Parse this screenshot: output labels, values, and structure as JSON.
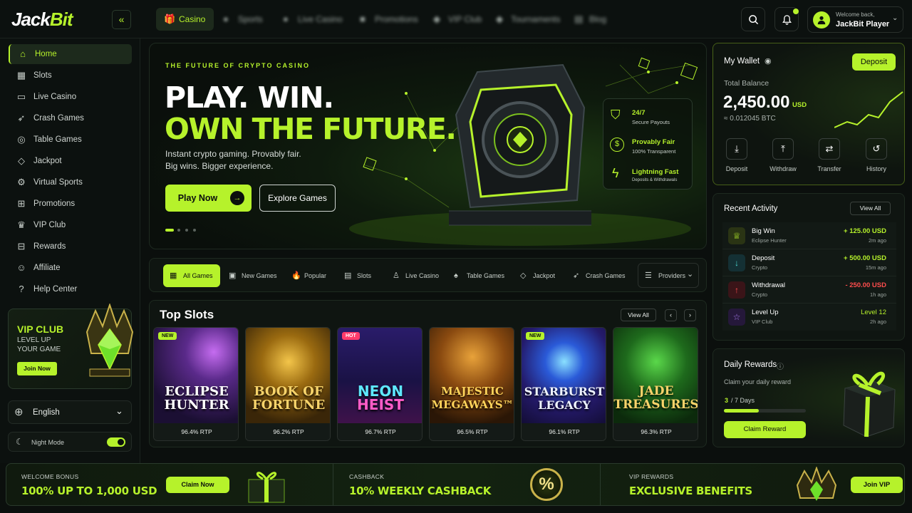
{
  "brand": {
    "logo_part1": "Jack",
    "logo_part2": "Bit"
  },
  "colors": {
    "accent": "#b6f22b",
    "background": "#0b0f0d",
    "up": "#b6f22b",
    "down": "#ff4d4d"
  },
  "top_nav": {
    "tabs": [
      {
        "label": "Casino",
        "icon": "gift-icon",
        "active": true
      },
      {
        "label": "Sports",
        "icon": "ball-icon"
      },
      {
        "label": "Live Casino",
        "icon": "dice-icon"
      },
      {
        "label": "Promotions",
        "icon": "gift-icon"
      },
      {
        "label": "VIP Club",
        "icon": "diamond-icon"
      },
      {
        "label": "Tournaments",
        "icon": "diamond-icon"
      },
      {
        "label": "Blog",
        "icon": "news-icon"
      }
    ]
  },
  "user": {
    "greeting": "Welcome back,",
    "name": "JackBit Player"
  },
  "sidebar": {
    "items": [
      {
        "label": "Home",
        "icon": "home-icon",
        "active": true
      },
      {
        "label": "Slots",
        "icon": "slots-icon"
      },
      {
        "label": "Live Casino",
        "icon": "live-casino-icon"
      },
      {
        "label": "Crash Games",
        "icon": "rocket-icon"
      },
      {
        "label": "Table Games",
        "icon": "table-icon"
      },
      {
        "label": "Jackpot",
        "icon": "jackpot-icon"
      },
      {
        "label": "Virtual Sports",
        "icon": "virtual-sports-icon"
      },
      {
        "label": "Promotions",
        "icon": "gift-icon"
      },
      {
        "label": "VIP Club",
        "icon": "crown-icon"
      },
      {
        "label": "Rewards",
        "icon": "rewards-icon"
      },
      {
        "label": "Affiliate",
        "icon": "user-icon"
      },
      {
        "label": "Help Center",
        "icon": "help-icon"
      }
    ],
    "vip": {
      "title": "VIP CLUB",
      "line1": "LEVEL UP",
      "line2": "YOUR GAME",
      "button": "Join Now"
    },
    "language": "English",
    "night_mode": {
      "label": "Night Mode",
      "on": true
    }
  },
  "hero": {
    "eyebrow": "THE FUTURE OF CRYPTO CASINO",
    "headline1": "PLAY. WIN.",
    "headline2": "OWN THE FUTURE.",
    "sub1": "Instant crypto gaming. Provably fair.",
    "sub2": "Big wins. Bigger experience.",
    "primary_button": "Play Now",
    "secondary_button": "Explore Games",
    "features": [
      {
        "title": "24/7",
        "sub": "Secure Payouts",
        "icon": "shield-icon"
      },
      {
        "title": "Provably Fair",
        "sub": "100% Transparent",
        "icon": "dollar-icon"
      },
      {
        "title": "Lightning Fast",
        "sub": "Deposits & Withdrawals",
        "icon": "lightning-icon"
      }
    ]
  },
  "filters": {
    "items": [
      {
        "label": "All Games",
        "icon": "grid-icon",
        "active": true
      },
      {
        "label": "New Games",
        "icon": "new-icon"
      },
      {
        "label": "Popular",
        "icon": "fire-icon"
      },
      {
        "label": "Slots",
        "icon": "slots-icon"
      },
      {
        "label": "Live Casino",
        "icon": "live-casino-icon"
      },
      {
        "label": "Table Games",
        "icon": "spade-icon"
      },
      {
        "label": "Jackpot",
        "icon": "diamond-icon"
      },
      {
        "label": "Crash Games",
        "icon": "rocket-icon"
      }
    ],
    "providers": "Providers"
  },
  "top_slots": {
    "title": "Top Slots",
    "view_all": "View All",
    "games": [
      {
        "name1": "ECLIPSE",
        "name2": "HUNTER",
        "rtp": "96.4% RTP",
        "tag": "NEW"
      },
      {
        "name1": "BOOK OF",
        "name2": "FORTUNE",
        "rtp": "96.2% RTP",
        "tag": ""
      },
      {
        "name1": "NEON",
        "name2": "HEIST",
        "rtp": "96.7% RTP",
        "tag": "HOT"
      },
      {
        "name1": "MAJESTIC",
        "name2": "MEGAWAYS™",
        "rtp": "96.5% RTP",
        "tag": ""
      },
      {
        "name1": "STARBURST",
        "name2": "LEGACY",
        "rtp": "96.1% RTP",
        "tag": "NEW"
      },
      {
        "name1": "JADE",
        "name2": "TREASURES",
        "rtp": "96.3% RTP",
        "tag": ""
      }
    ]
  },
  "wallet": {
    "title": "My Wallet",
    "deposit_button": "Deposit",
    "balance_label": "Total Balance",
    "balance": "2,450.00",
    "currency": "USD",
    "btc": "≈ 0.012045 BTC",
    "actions": [
      {
        "label": "Deposit",
        "icon": "download-icon"
      },
      {
        "label": "Withdraw",
        "icon": "upload-icon"
      },
      {
        "label": "Transfer",
        "icon": "transfer-icon"
      },
      {
        "label": "History",
        "icon": "history-icon"
      }
    ]
  },
  "activity": {
    "title": "Recent Activity",
    "view_all": "View All",
    "rows": [
      {
        "title": "Big Win",
        "sub": "Eclipse Hunter",
        "amount": "+ 125.00 USD",
        "time": "2m ago",
        "icon": "trophy-icon",
        "kind": "up"
      },
      {
        "title": "Deposit",
        "sub": "Crypto",
        "amount": "+ 500.00 USD",
        "time": "15m ago",
        "icon": "arrow-down-icon",
        "kind": "up"
      },
      {
        "title": "Withdrawal",
        "sub": "Crypto",
        "amount": "- 250.00 USD",
        "time": "1h ago",
        "icon": "arrow-up-icon",
        "kind": "down"
      },
      {
        "title": "Level Up",
        "sub": "VIP Club",
        "amount": "Level 12",
        "time": "2h ago",
        "icon": "star-icon",
        "kind": "up"
      }
    ]
  },
  "daily": {
    "title": "Daily Rewards",
    "sub": "Claim your daily reward",
    "progress_current": "3",
    "progress_text": "/ 7 Days",
    "progress_fraction": 0.4286,
    "button": "Claim Reward"
  },
  "promo": {
    "welcome": {
      "caption": "WELCOME BONUS",
      "text": "100% UP TO 1,000 USD",
      "button": "Claim Now"
    },
    "cashback": {
      "caption": "CASHBACK",
      "text": "10% WEEKLY CASHBACK",
      "badge": "%"
    },
    "vip": {
      "caption": "VIP REWARDS",
      "text": "EXCLUSIVE BENEFITS",
      "button": "Join VIP"
    }
  }
}
